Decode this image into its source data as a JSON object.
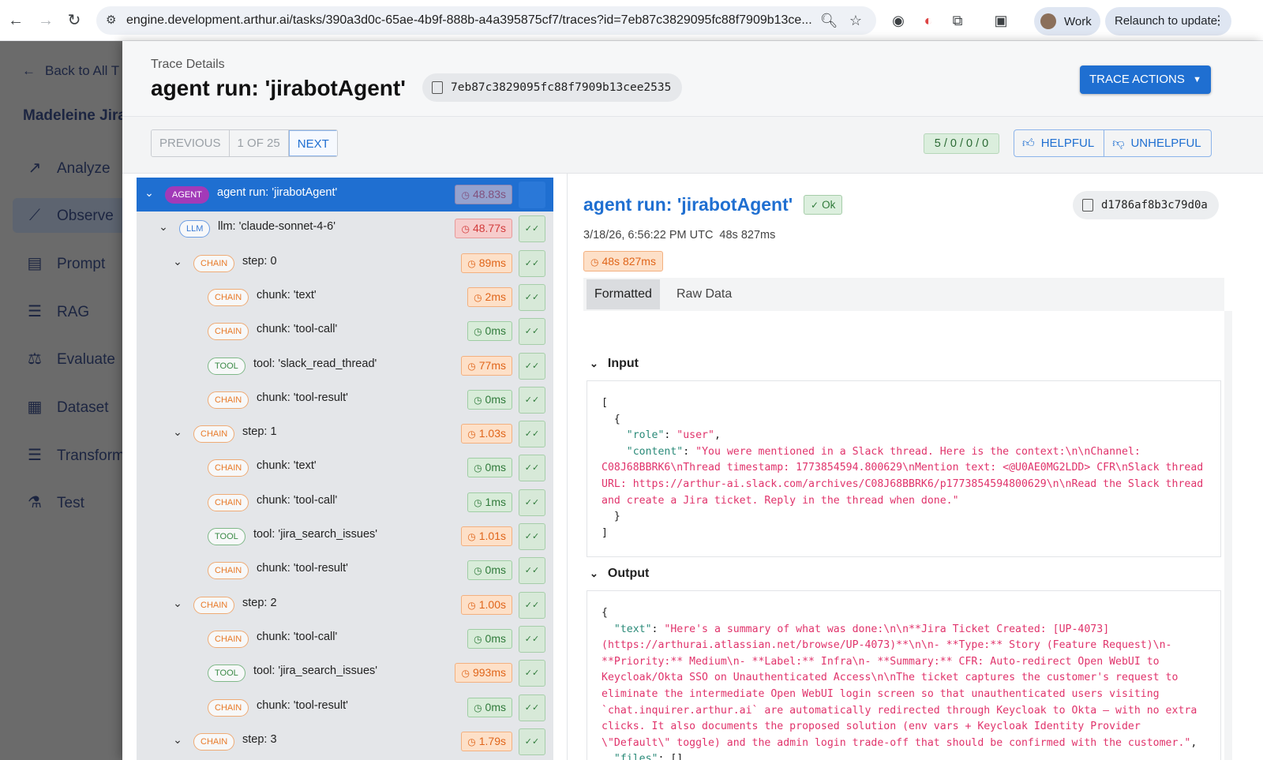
{
  "browser": {
    "url": "engine.development.arthur.ai/tasks/390a3d0c-65ae-4b9f-888b-a4a395875cf7/traces?id=7eb87c3829095fc88f7909b13ce...",
    "profile_label": "Work",
    "relaunch_label": "Relaunch to update"
  },
  "sidebar": {
    "back_label": "Back to All T",
    "project_name": "Madeleine Jira",
    "items": [
      {
        "label": "Analyze",
        "icon": "trend-icon"
      },
      {
        "label": "Observe",
        "icon": "chart-line-icon"
      },
      {
        "label": "Prompt",
        "icon": "document-icon"
      },
      {
        "label": "RAG",
        "icon": "list-icon"
      },
      {
        "label": "Evaluate",
        "icon": "scale-icon"
      },
      {
        "label": "Dataset",
        "icon": "table-icon"
      },
      {
        "label": "Transform",
        "icon": "list-icon"
      },
      {
        "label": "Test",
        "icon": "flask-icon"
      }
    ]
  },
  "header": {
    "label": "Trace Details",
    "title": "agent run: 'jirabotAgent'",
    "trace_id": "7eb87c3829095fc88f7909b13cee2535",
    "actions_label": "TRACE ACTIONS"
  },
  "nav": {
    "previous": "PREVIOUS",
    "position": "1 OF 25",
    "next": "NEXT",
    "score": "5 / 0 / 0 / 0",
    "helpful": "HELPFUL",
    "unhelpful": "UNHELPFUL"
  },
  "tree": [
    {
      "type": "AGENT",
      "name": "agent run: 'jirabotAgent'",
      "duration": "48.83s",
      "level": 0,
      "expanded": true,
      "color": "red",
      "selected": true
    },
    {
      "type": "LLM",
      "name": "llm: 'claude-sonnet-4-6'",
      "duration": "48.77s",
      "level": 1,
      "expanded": true,
      "color": "red"
    },
    {
      "type": "CHAIN",
      "name": "step: 0",
      "duration": "89ms",
      "level": 2,
      "expanded": true,
      "color": "orange"
    },
    {
      "type": "CHAIN",
      "name": "chunk: 'text'",
      "duration": "2ms",
      "level": 3,
      "color": "orange"
    },
    {
      "type": "CHAIN",
      "name": "chunk: 'tool-call'",
      "duration": "0ms",
      "level": 3,
      "color": "green"
    },
    {
      "type": "TOOL",
      "name": "tool: 'slack_read_thread'",
      "duration": "77ms",
      "level": 3,
      "color": "orange"
    },
    {
      "type": "CHAIN",
      "name": "chunk: 'tool-result'",
      "duration": "0ms",
      "level": 3,
      "color": "green"
    },
    {
      "type": "CHAIN",
      "name": "step: 1",
      "duration": "1.03s",
      "level": 2,
      "expanded": true,
      "color": "orange"
    },
    {
      "type": "CHAIN",
      "name": "chunk: 'text'",
      "duration": "0ms",
      "level": 3,
      "color": "green"
    },
    {
      "type": "CHAIN",
      "name": "chunk: 'tool-call'",
      "duration": "1ms",
      "level": 3,
      "color": "green"
    },
    {
      "type": "TOOL",
      "name": "tool: 'jira_search_issues'",
      "duration": "1.01s",
      "level": 3,
      "color": "orange"
    },
    {
      "type": "CHAIN",
      "name": "chunk: 'tool-result'",
      "duration": "0ms",
      "level": 3,
      "color": "green"
    },
    {
      "type": "CHAIN",
      "name": "step: 2",
      "duration": "1.00s",
      "level": 2,
      "expanded": true,
      "color": "orange"
    },
    {
      "type": "CHAIN",
      "name": "chunk: 'tool-call'",
      "duration": "0ms",
      "level": 3,
      "color": "green"
    },
    {
      "type": "TOOL",
      "name": "tool: 'jira_search_issues'",
      "duration": "993ms",
      "level": 3,
      "color": "orange"
    },
    {
      "type": "CHAIN",
      "name": "chunk: 'tool-result'",
      "duration": "0ms",
      "level": 3,
      "color": "green"
    },
    {
      "type": "CHAIN",
      "name": "step: 3",
      "duration": "1.79s",
      "level": 2,
      "expanded": true,
      "color": "orange"
    }
  ],
  "detail": {
    "title": "agent run: 'jirabotAgent'",
    "status": "Ok",
    "span_id": "d1786af8b3c79d0a",
    "timestamp": "3/18/26, 6:56:22 PM UTC",
    "elapsed": "48s 827ms",
    "duration": "48s 827ms",
    "tabs": [
      "Formatted",
      "Raw Data"
    ],
    "input_label": "Input",
    "output_label": "Output",
    "input": {
      "open_bracket": "[",
      "open_brace": "{",
      "role_key": "\"role\"",
      "role_value": "\"user\"",
      "content_key": "\"content\"",
      "content_value": "\"You were mentioned in a Slack thread. Here is the context:\\n\\nChannel: C08J68BBRK6\\nThread timestamp: 1773854594.800629\\nMention text: <@U0AE0MG2LDD> CFR\\nSlack thread URL: https://arthur-ai.slack.com/archives/C08J68BBRK6/p1773854594800629\\n\\nRead the Slack thread and create a Jira ticket. Reply in the thread when done.\"",
      "close_brace": "}",
      "close_bracket": "]"
    },
    "output": {
      "open_brace": "{",
      "text_key": "\"text\"",
      "text_value": "\"Here's a summary of what was done:\\n\\n**Jira Ticket Created: [UP-4073](https://arthurai.atlassian.net/browse/UP-4073)**\\n\\n- **Type:** Story (Feature Request)\\n- **Priority:** Medium\\n- **Label:** Infra\\n- **Summary:** CFR: Auto-redirect Open WebUI to Keycloak/Okta SSO on Unauthenticated Access\\n\\nThe ticket captures the customer's request to eliminate the intermediate Open WebUI login screen so that unauthenticated users visiting `chat.inquirer.arthur.ai` are automatically redirected through Keycloak to Okta — with no extra clicks. It also documents the proposed solution (env vars + Keycloak Identity Provider \\\"Default\\\" toggle) and the admin login trade-off that should be confirmed with the customer.\"",
      "files_key": "\"files\"",
      "files_value": "[]"
    }
  }
}
